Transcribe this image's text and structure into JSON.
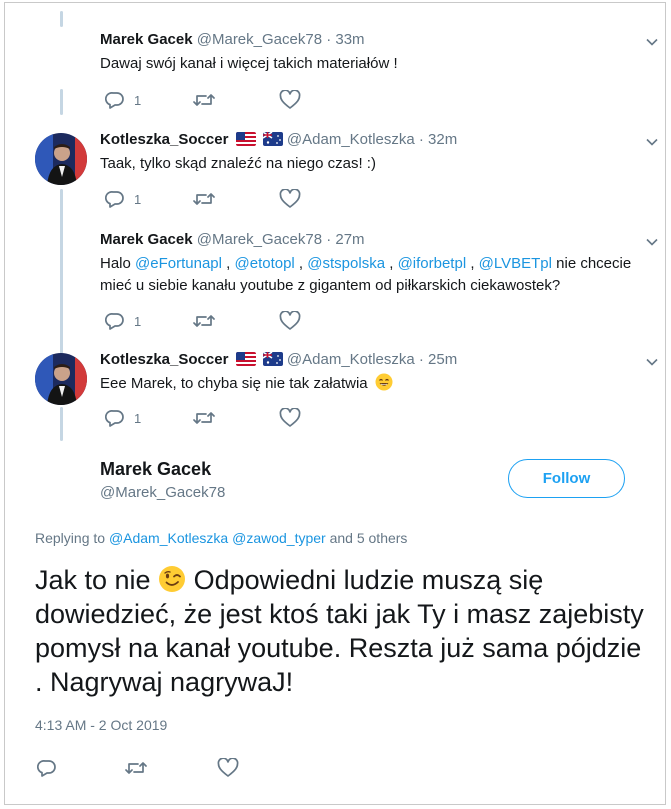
{
  "replies": [
    {
      "name": "Marek Gacek",
      "handle": "@Marek_Gacek78",
      "time": "· 33m",
      "text": "Dawaj swój kanał i więcej takich materiałów !",
      "reply_count": "1"
    },
    {
      "name": "Kotleszka_Soccer",
      "handle": "@Adam_Kotleszka",
      "time": "· 32m",
      "text": "Taak, tylko skąd znaleźć na niego czas! :)",
      "reply_count": "1"
    },
    {
      "name": "Marek Gacek",
      "handle": "@Marek_Gacek78",
      "time": "· 27m",
      "text_prefix": "Halo ",
      "mentions": [
        "@eFortunapl",
        "@etotopl",
        "@stspolska",
        "@iforbetpl",
        "@LVBETpl"
      ],
      "separator": " , ",
      "text_suffix": " nie chcecie mieć u siebie kanału youtube z gigantem od piłkarskich ciekawostek?",
      "reply_count": "1"
    },
    {
      "name": "Kotleszka_Soccer",
      "handle": "@Adam_Kotleszka",
      "time": "· 25m",
      "text": "Eee Marek, to chyba się nie tak załatwia",
      "reply_count": "1"
    }
  ],
  "main_tweet": {
    "name": "Marek Gacek",
    "handle": "@Marek_Gacek78",
    "follow_label": "Follow",
    "replying_prefix": "Replying to ",
    "replying_mention_1": "@Adam_Kotleszka",
    "replying_mention_2": "@zawod_typer",
    "replying_suffix": " and 5 others",
    "text_part1": "Jak to nie ",
    "text_part2": " Odpowiedni ludzie muszą się dowiedzieć, że jest ktoś taki jak Ty i masz zajebisty pomysł na kanał youtube. Reszta już sama pójdzie . Nagrywaj nagrywaJ!",
    "timestamp": "4:13 AM - 2 Oct 2019"
  },
  "colors": {
    "accent": "#1da1f2",
    "mention": "#1b95e0",
    "muted": "#657786",
    "thread_line": "#c5d6e3"
  },
  "icons": [
    "reply-icon",
    "retweet-icon",
    "like-icon",
    "chevron-down-icon",
    "smiling-emoji-icon",
    "winking-emoji-icon",
    "us-flag-icon",
    "australia-flag-icon"
  ]
}
